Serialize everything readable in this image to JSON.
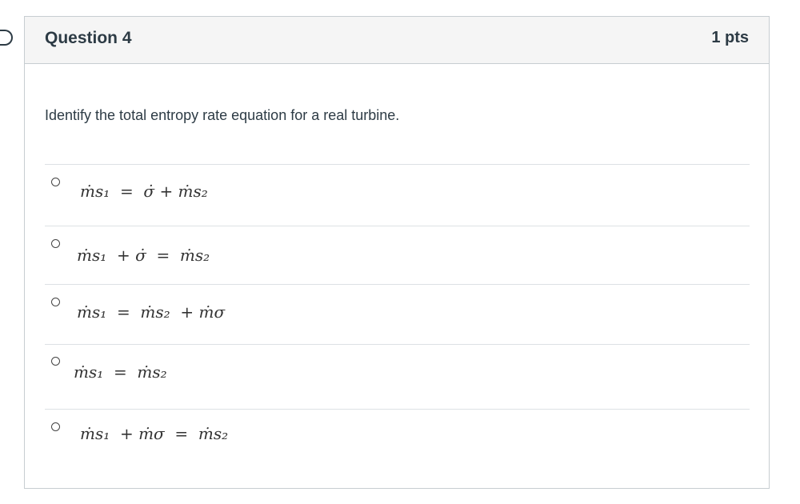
{
  "question": {
    "title": "Question 4",
    "points": "1 pts",
    "text": "Identify the total entropy rate equation for a real turbine."
  },
  "answers": [
    {
      "equation": "ṁs₁  =  σ̇ + ṁs₂"
    },
    {
      "equation": "ṁs₁  + σ̇  =  ṁs₂"
    },
    {
      "equation": "ṁs₁  =  ṁs₂  + ṁσ"
    },
    {
      "equation": "ṁs₁  =  ṁs₂"
    },
    {
      "equation": "ṁs₁  + ṁσ  =  ṁs₂"
    }
  ]
}
